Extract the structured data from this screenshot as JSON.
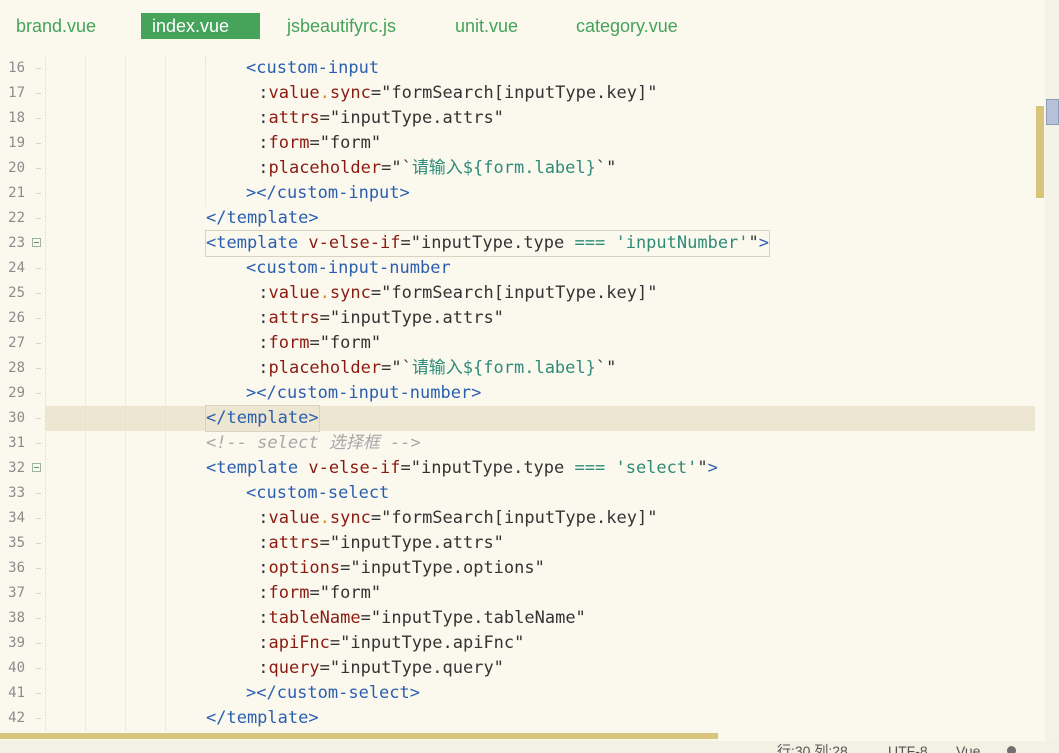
{
  "tabs": [
    {
      "label": "brand.vue",
      "active": false
    },
    {
      "label": "index.vue",
      "active": true
    },
    {
      "label": "jsbeautifyrc.js",
      "active": false
    },
    {
      "label": "unit.vue",
      "active": false
    },
    {
      "label": "category.vue",
      "active": false
    }
  ],
  "editor": {
    "current_line": 30,
    "lines": [
      {
        "num": "16",
        "tokens": [
          [
            "t",
            "<custom-input"
          ]
        ]
      },
      {
        "num": "17",
        "tokens": [
          [
            "p",
            " :"
          ],
          [
            "a",
            "value"
          ],
          [
            "d",
            "."
          ],
          [
            "a",
            "sync"
          ],
          [
            "p",
            "="
          ],
          [
            "s",
            "\"formSearch[inputType.key]\""
          ]
        ]
      },
      {
        "num": "18",
        "tokens": [
          [
            "p",
            " :"
          ],
          [
            "a",
            "attrs"
          ],
          [
            "p",
            "="
          ],
          [
            "s",
            "\"inputType.attrs\""
          ]
        ]
      },
      {
        "num": "19",
        "tokens": [
          [
            "p",
            " :"
          ],
          [
            "a",
            "form"
          ],
          [
            "p",
            "="
          ],
          [
            "s",
            "\"form\""
          ]
        ]
      },
      {
        "num": "20",
        "tokens": [
          [
            "p",
            " :"
          ],
          [
            "a",
            "placeholder"
          ],
          [
            "p",
            "="
          ],
          [
            "s",
            "\"`"
          ],
          [
            "s2",
            "请输入${form.label}"
          ],
          [
            "s",
            "`\""
          ]
        ]
      },
      {
        "num": "21",
        "tokens": [
          [
            "t",
            "></custom-input>"
          ]
        ]
      },
      {
        "num": "22",
        "tokens": [
          [
            "t",
            "</template>"
          ]
        ]
      },
      {
        "num": "23",
        "fold": true,
        "boxed": true,
        "tokens": [
          [
            "t",
            "<template "
          ],
          [
            "a",
            "v-else-if"
          ],
          [
            "p",
            "="
          ],
          [
            "s",
            "\"inputType.type "
          ],
          [
            "o",
            "==="
          ],
          [
            "s",
            " "
          ],
          [
            "s2",
            "'inputNumber'"
          ],
          [
            "s",
            "\""
          ],
          [
            "t",
            ">"
          ]
        ]
      },
      {
        "num": "24",
        "tokens": [
          [
            "t",
            "<custom-input-number"
          ]
        ]
      },
      {
        "num": "25",
        "tokens": [
          [
            "p",
            " :"
          ],
          [
            "a",
            "value"
          ],
          [
            "d",
            "."
          ],
          [
            "a",
            "sync"
          ],
          [
            "p",
            "="
          ],
          [
            "s",
            "\"formSearch[inputType.key]\""
          ]
        ]
      },
      {
        "num": "26",
        "tokens": [
          [
            "p",
            " :"
          ],
          [
            "a",
            "attrs"
          ],
          [
            "p",
            "="
          ],
          [
            "s",
            "\"inputType.attrs\""
          ]
        ]
      },
      {
        "num": "27",
        "tokens": [
          [
            "p",
            " :"
          ],
          [
            "a",
            "form"
          ],
          [
            "p",
            "="
          ],
          [
            "s",
            "\"form\""
          ]
        ]
      },
      {
        "num": "28",
        "tokens": [
          [
            "p",
            " :"
          ],
          [
            "a",
            "placeholder"
          ],
          [
            "p",
            "="
          ],
          [
            "s",
            "\"`"
          ],
          [
            "s2",
            "请输入${form.label}"
          ],
          [
            "s",
            "`\""
          ]
        ]
      },
      {
        "num": "29",
        "tokens": [
          [
            "t",
            "></custom-input-number>"
          ]
        ]
      },
      {
        "num": "30",
        "boxed": true,
        "tokens": [
          [
            "t",
            "</template>"
          ]
        ]
      },
      {
        "num": "31",
        "tokens": [
          [
            "c",
            "<!-- select 选择框 -->"
          ]
        ]
      },
      {
        "num": "32",
        "fold": true,
        "tokens": [
          [
            "t",
            "<template "
          ],
          [
            "a",
            "v-else-if"
          ],
          [
            "p",
            "="
          ],
          [
            "s",
            "\"inputType.type "
          ],
          [
            "o",
            "==="
          ],
          [
            "s",
            " "
          ],
          [
            "s2",
            "'select'"
          ],
          [
            "s",
            "\""
          ],
          [
            "t",
            ">"
          ]
        ]
      },
      {
        "num": "33",
        "tokens": [
          [
            "t",
            "<custom-select"
          ]
        ]
      },
      {
        "num": "34",
        "tokens": [
          [
            "p",
            " :"
          ],
          [
            "a",
            "value"
          ],
          [
            "d",
            "."
          ],
          [
            "a",
            "sync"
          ],
          [
            "p",
            "="
          ],
          [
            "s",
            "\"formSearch[inputType.key]\""
          ]
        ]
      },
      {
        "num": "35",
        "tokens": [
          [
            "p",
            " :"
          ],
          [
            "a",
            "attrs"
          ],
          [
            "p",
            "="
          ],
          [
            "s",
            "\"inputType.attrs\""
          ]
        ]
      },
      {
        "num": "36",
        "tokens": [
          [
            "p",
            " :"
          ],
          [
            "a",
            "options"
          ],
          [
            "p",
            "="
          ],
          [
            "s",
            "\"inputType.options\""
          ]
        ]
      },
      {
        "num": "37",
        "tokens": [
          [
            "p",
            " :"
          ],
          [
            "a",
            "form"
          ],
          [
            "p",
            "="
          ],
          [
            "s",
            "\"form\""
          ]
        ]
      },
      {
        "num": "38",
        "tokens": [
          [
            "p",
            " :"
          ],
          [
            "a",
            "tableName"
          ],
          [
            "p",
            "="
          ],
          [
            "s",
            "\"inputType.tableName\""
          ]
        ]
      },
      {
        "num": "39",
        "tokens": [
          [
            "p",
            " :"
          ],
          [
            "a",
            "apiFnc"
          ],
          [
            "p",
            "="
          ],
          [
            "s",
            "\"inputType.apiFnc\""
          ]
        ]
      },
      {
        "num": "40",
        "tokens": [
          [
            "p",
            " :"
          ],
          [
            "a",
            "query"
          ],
          [
            "p",
            "="
          ],
          [
            "s",
            "\"inputType.query\""
          ]
        ]
      },
      {
        "num": "41",
        "tokens": [
          [
            "t",
            "></custom-select>"
          ]
        ]
      },
      {
        "num": "42",
        "tokens": [
          [
            "t",
            "</template>"
          ]
        ]
      }
    ]
  },
  "status": {
    "position": "行:30  列:28",
    "encoding": "UTF-8",
    "language": "Vue"
  },
  "colors": {
    "accent": "#45a35a",
    "tag": "#2a5fb0",
    "attribute": "#8b1a10",
    "string_literal": "#2e8b77",
    "comment": "#a8a8a8",
    "current_line": "#ede6d0",
    "background": "#fbf8ee"
  }
}
